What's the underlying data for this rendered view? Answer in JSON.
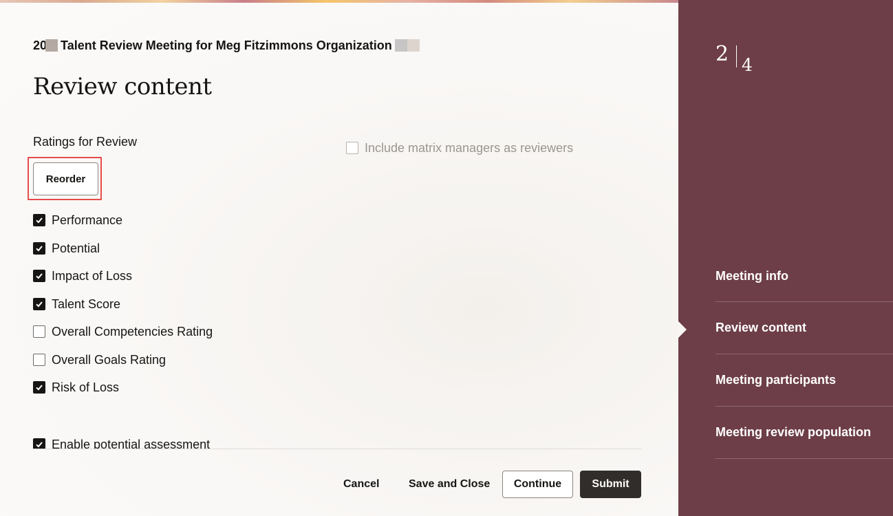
{
  "header": {
    "meeting_title_prefix": "20",
    "meeting_title_main": "Talent Review Meeting for Meg Fitzimmons Organization"
  },
  "page": {
    "heading": "Review content"
  },
  "ratings": {
    "section_label": "Ratings for Review",
    "reorder_label": "Reorder",
    "items": [
      {
        "label": "Performance",
        "checked": true
      },
      {
        "label": "Potential",
        "checked": true
      },
      {
        "label": "Impact of Loss",
        "checked": true
      },
      {
        "label": "Talent Score",
        "checked": true
      },
      {
        "label": "Overall Competencies Rating",
        "checked": false
      },
      {
        "label": "Overall Goals Rating",
        "checked": false
      },
      {
        "label": "Risk of Loss",
        "checked": true
      }
    ],
    "potential_assessment": {
      "label": "Enable potential assessment",
      "checked": true
    }
  },
  "options": {
    "matrix_managers": {
      "label": "Include matrix managers as reviewers",
      "checked": false,
      "disabled": true
    }
  },
  "footer": {
    "cancel_label": "Cancel",
    "save_close_label": "Save and Close",
    "continue_label": "Continue",
    "submit_label": "Submit"
  },
  "sidebar": {
    "current_step": "2",
    "total_steps": "4",
    "steps": [
      {
        "label": "Meeting info"
      },
      {
        "label": "Review content",
        "current": true
      },
      {
        "label": "Meeting participants"
      },
      {
        "label": "Meeting review population"
      }
    ]
  },
  "colors": {
    "sidebar_bg": "#6d3e47",
    "primary_button": "#312d2a",
    "highlight_outline": "#e54c4c"
  }
}
